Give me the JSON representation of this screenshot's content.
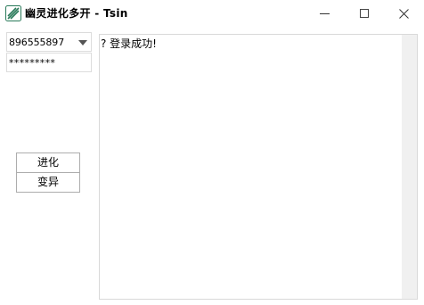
{
  "window": {
    "title": "幽灵进化多开 - Tsin",
    "icon": "app-logo-icon",
    "controls": [
      "minimize-icon",
      "maximize-icon",
      "close-icon"
    ]
  },
  "login": {
    "account_value": "896555897",
    "password_value": "*********"
  },
  "buttons": {
    "evolve_label": "进化",
    "mutate_label": "变异"
  },
  "log": {
    "text": "? 登录成功!"
  },
  "colors": {
    "logo": "#2a7a5a",
    "scrollbar_track": "#f0f0f0",
    "border": "#dcdcdc"
  }
}
